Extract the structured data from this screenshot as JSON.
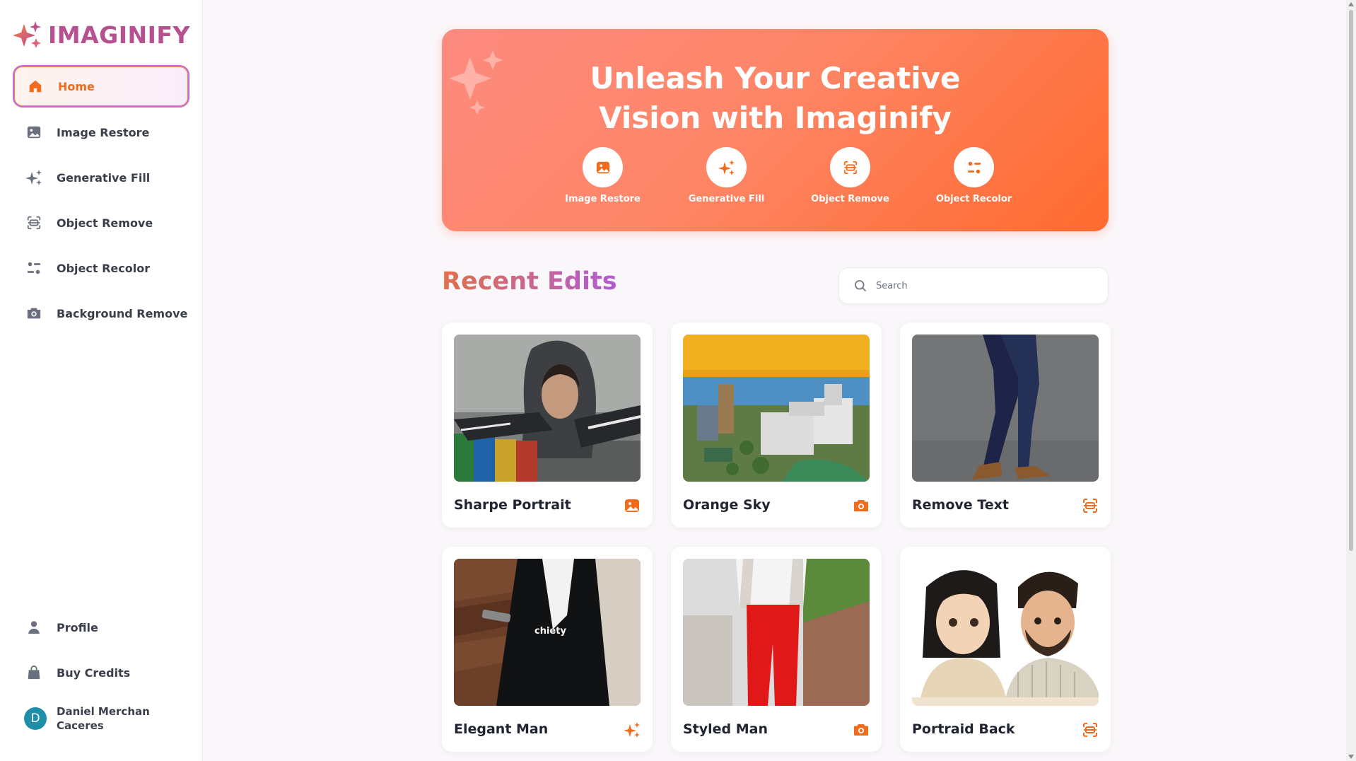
{
  "app": {
    "brand": "IMAGINIFY",
    "brand_color": "#b6508f",
    "accent": "#f06b1b"
  },
  "sidebar": {
    "items": [
      {
        "label": "Home",
        "icon": "home-icon",
        "active": true
      },
      {
        "label": "Image Restore",
        "icon": "image-icon"
      },
      {
        "label": "Generative Fill",
        "icon": "sparkles-icon"
      },
      {
        "label": "Object Remove",
        "icon": "scan-icon"
      },
      {
        "label": "Object Recolor",
        "icon": "filter-icon"
      },
      {
        "label": "Background Remove",
        "icon": "camera-icon"
      }
    ],
    "bottom_items": [
      {
        "label": "Profile",
        "icon": "user-icon"
      },
      {
        "label": "Buy Credits",
        "icon": "bag-icon"
      }
    ],
    "user": {
      "initial": "D",
      "name": "Daniel Merchan Caceres"
    }
  },
  "hero": {
    "title_line1": "Unleash Your Creative",
    "title_line2": "Vision with Imaginify",
    "tools": [
      {
        "label": "Image Restore",
        "icon": "image-icon"
      },
      {
        "label": "Generative Fill",
        "icon": "sparkles-icon"
      },
      {
        "label": "Object Remove",
        "icon": "scan-icon"
      },
      {
        "label": "Object Recolor",
        "icon": "filter-icon"
      }
    ]
  },
  "recent": {
    "title": "Recent Edits",
    "search_placeholder": "Search",
    "cards": [
      {
        "title": "Sharpe Portrait",
        "icon": "image-icon",
        "image": "woman-in-hood-photo"
      },
      {
        "title": "Orange Sky",
        "icon": "camera-icon",
        "image": "city-orange-sky-photo"
      },
      {
        "title": "Remove Text",
        "icon": "scan-icon",
        "image": "walking-pants-photo"
      },
      {
        "title": "Elegant Man",
        "icon": "sparkles-icon",
        "image": "man-in-coat-photo",
        "overlay_text": "chiety"
      },
      {
        "title": "Styled Man",
        "icon": "camera-icon",
        "image": "red-pants-photo"
      },
      {
        "title": "Portraid Back",
        "icon": "scan-icon",
        "image": "cartoon-couple-illustration"
      }
    ]
  }
}
